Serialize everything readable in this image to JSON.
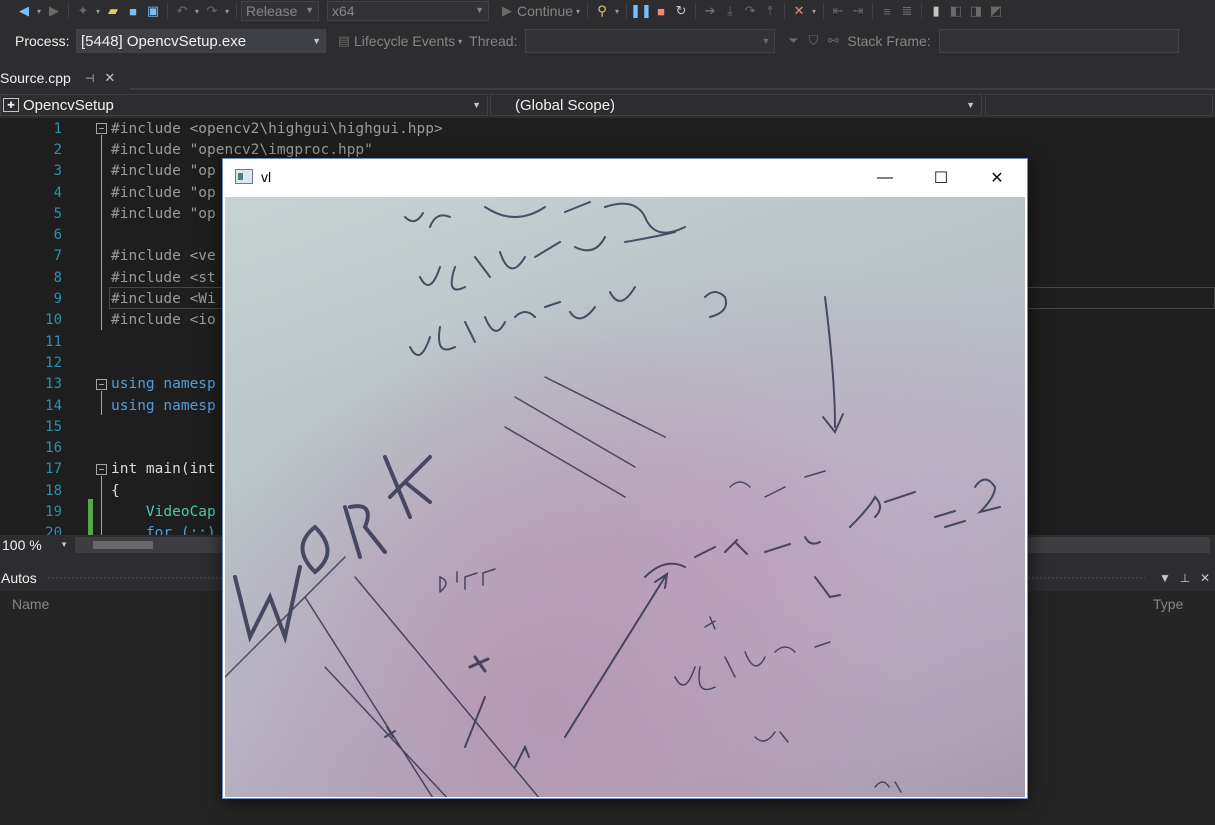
{
  "toolbar": {
    "configuration": "Release",
    "platform": "x64",
    "continue_label": "Continue"
  },
  "process_bar": {
    "process_label": "Process:",
    "process_value": "[5448] OpencvSetup.exe",
    "lifecycle_label": "Lifecycle Events",
    "thread_label": "Thread:",
    "stack_frame_label": "Stack Frame:"
  },
  "tab": {
    "filename": "Source.cpp",
    "pin_icon": "pin-icon",
    "close_icon": "close-icon"
  },
  "nav": {
    "project": "OpencvSetup",
    "scope": "(Global Scope)"
  },
  "editor": {
    "lines": [
      {
        "num": "1",
        "text": "#include <opencv2\\highgui\\highgui.hpp>"
      },
      {
        "num": "2",
        "text": "#include \"opencv2\\imgproc.hpp\""
      },
      {
        "num": "3",
        "text": "#include \"op"
      },
      {
        "num": "4",
        "text": "#include \"op"
      },
      {
        "num": "5",
        "text": "#include \"op"
      },
      {
        "num": "6",
        "text": ""
      },
      {
        "num": "7",
        "text": "#include <ve"
      },
      {
        "num": "8",
        "text": "#include <st"
      },
      {
        "num": "9",
        "text": "#include <Wi"
      },
      {
        "num": "10",
        "text": "#include <io"
      },
      {
        "num": "11",
        "text": ""
      },
      {
        "num": "12",
        "text": ""
      },
      {
        "num": "13",
        "text": "using namesp"
      },
      {
        "num": "14",
        "text": "using namesp"
      },
      {
        "num": "15",
        "text": ""
      },
      {
        "num": "16",
        "text": ""
      },
      {
        "num": "17",
        "text": "int main(int"
      },
      {
        "num": "18",
        "text": "{"
      },
      {
        "num": "19",
        "text": "    VideoCap"
      },
      {
        "num": "20",
        "text": "    for (;;)"
      }
    ]
  },
  "zoom": {
    "level": "100 %"
  },
  "autos": {
    "title": "Autos",
    "col_name": "Name",
    "col_type": "Type"
  },
  "popup": {
    "title": "vl",
    "image_desc": "webcam frame"
  }
}
